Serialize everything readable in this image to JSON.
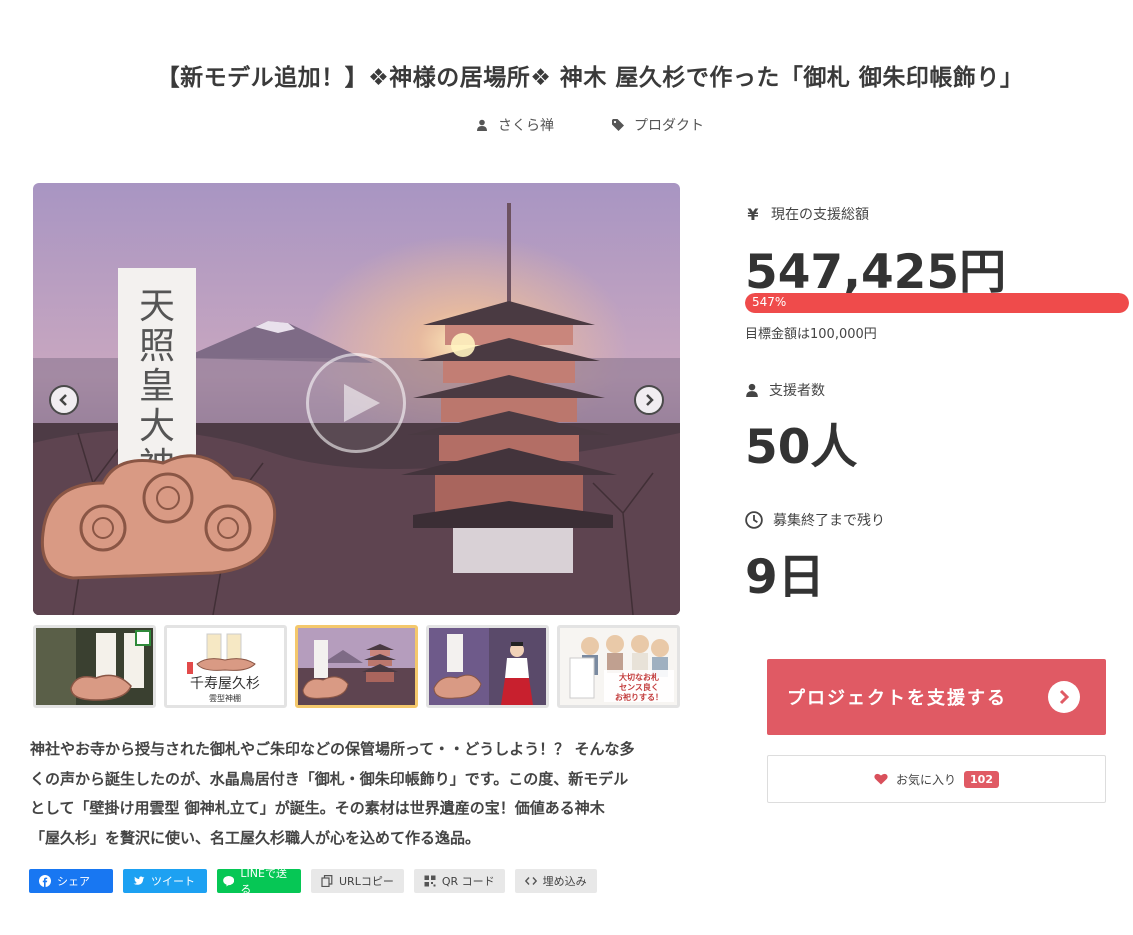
{
  "title": "【新モデル追加！】❖神様の居場所❖ 神木 屋久杉で作った「御札 御朱印帳飾り」",
  "meta": {
    "author": "さくら禅",
    "category": "プロダクト"
  },
  "media": {
    "play_icon": "play-icon",
    "prev_icon": "chevron-left-icon",
    "next_icon": "chevron-right-icon",
    "main_ofuda_text": "天照皇大神宮"
  },
  "thumbnails": [
    {
      "caption": "千寿屋久杉",
      "active": false
    },
    {
      "caption": "千寿屋久杉 雲型神棚",
      "active": false
    },
    {
      "caption": "",
      "active": true
    },
    {
      "caption": "",
      "active": false
    },
    {
      "caption": "大切なお札 センス良く お祀りする！",
      "active": false
    }
  ],
  "description": {
    "line1": "神社やお寺から授与された御札やご朱印などの保管場所って・・どうしよう！？ そんな多",
    "line2": "くの声から誕生したのが、水晶鳥居付き「御札・御朱印帳飾り」です。この度、新モデル",
    "line3": "として「壁掛け用雲型 御神札立て」が誕生。その素材は世界遺産の宝！価値ある神木",
    "line4": "「屋久杉」を贅沢に使い、名工屋久杉職人が心を込めて作る逸品。"
  },
  "share": {
    "facebook": "シェア",
    "twitter": "ツイート",
    "line": "LINEで送る",
    "url_copy": "URLコピー",
    "qr": "QR コード",
    "embed": "埋め込み"
  },
  "stats": {
    "amount_label": "現在の支援総額",
    "amount_value": "547,425円",
    "progress_text": "547%",
    "progress_percent": 547,
    "goal_text": "目標金額は100,000円",
    "backers_label": "支援者数",
    "backers_value": "50人",
    "remaining_label": "募集終了まで残り",
    "remaining_value": "9日"
  },
  "actions": {
    "support_label": "プロジェクトを支援する",
    "favorite_label": "お気に入り",
    "favorite_count": "102"
  },
  "colors": {
    "accent": "#e05a64",
    "progress": "#ef4b4b",
    "facebook": "#1877f2",
    "twitter": "#1da1f2",
    "line": "#06c755"
  }
}
